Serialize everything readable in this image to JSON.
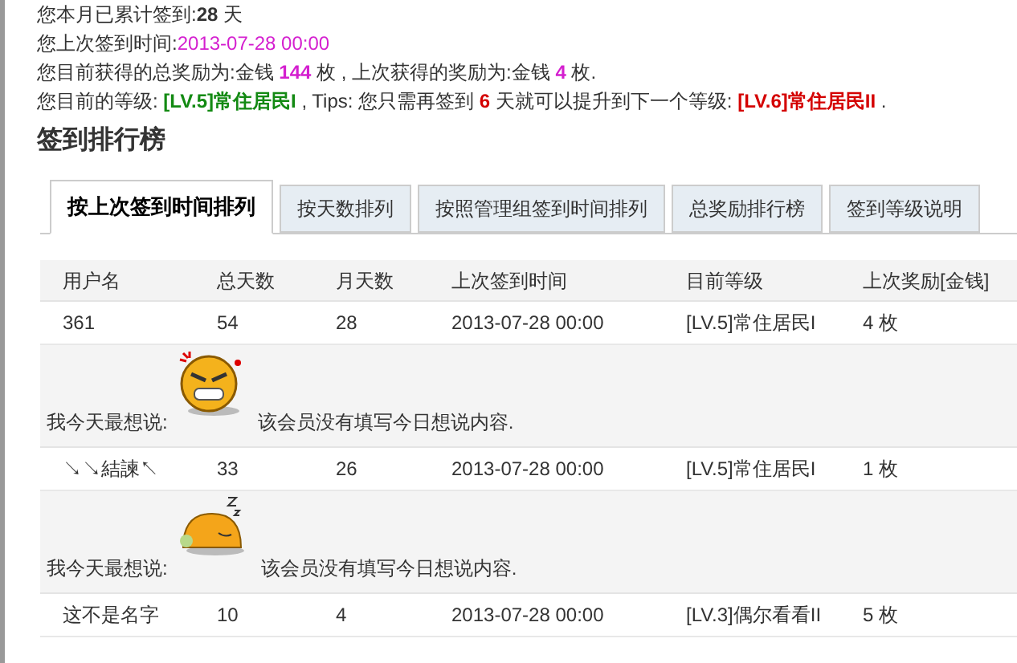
{
  "summary": [
    [
      {
        "text": "您本月已累计签到:",
        "kind": "plain"
      },
      {
        "text": "28",
        "kind": "bold"
      },
      {
        "text": " 天",
        "kind": "plain"
      }
    ],
    [
      {
        "text": "您上次签到时间:",
        "kind": "plain"
      },
      {
        "text": "2013-07-28 00:00",
        "kind": "magenta"
      }
    ],
    [
      {
        "text": "您目前获得的总奖励为:金钱 ",
        "kind": "plain"
      },
      {
        "text": "144",
        "kind": "magenta-bold"
      },
      {
        "text": " 枚 , 上次获得的奖励为:金钱 ",
        "kind": "plain"
      },
      {
        "text": "4",
        "kind": "magenta-bold"
      },
      {
        "text": " 枚.",
        "kind": "plain"
      }
    ],
    [
      {
        "text": "您目前的等级: ",
        "kind": "plain"
      },
      {
        "text": "[LV.5]常住居民I",
        "kind": "green-bold"
      },
      {
        "text": " , Tips: 您只需再签到 ",
        "kind": "plain"
      },
      {
        "text": "6",
        "kind": "red-bold"
      },
      {
        "text": " 天就可以提升到下一个等级: ",
        "kind": "plain"
      },
      {
        "text": "[LV.6]常住居民II",
        "kind": "red-bold"
      },
      {
        "text": " .",
        "kind": "plain"
      }
    ]
  ],
  "heading": "签到排行榜",
  "tabs": [
    {
      "label": "按上次签到时间排列",
      "selected": true
    },
    {
      "label": "按天数排列",
      "selected": false
    },
    {
      "label": "按照管理组签到时间排列",
      "selected": false
    },
    {
      "label": "总奖励排行榜",
      "selected": false
    },
    {
      "label": "签到等级说明",
      "selected": false
    }
  ],
  "table": {
    "columns": [
      "用户名",
      "总天数",
      "月天数",
      "上次签到时间",
      "目前等级",
      "上次奖励[金钱]"
    ],
    "rows": [
      {
        "cells": [
          "361",
          "54",
          "28",
          "2013-07-28 00:00",
          "[LV.5]常住居民I",
          "4 枚"
        ],
        "message": {
          "label": "我今天最想说:",
          "kind": "angry",
          "text": "该会员没有填写今日想说内容."
        }
      },
      {
        "cells": [
          "↘↘結諫↖",
          "33",
          "26",
          "2013-07-28 00:00",
          "[LV.5]常住居民I",
          "1 枚"
        ],
        "message": {
          "label": "我今天最想说:",
          "kind": "sleepy",
          "text": "该会员没有填写今日想说内容."
        }
      },
      {
        "cells": [
          "这不是名字",
          "10",
          "4",
          "2013-07-28 00:00",
          "[LV.3]偶尔看看II",
          "5 枚"
        ]
      }
    ]
  }
}
